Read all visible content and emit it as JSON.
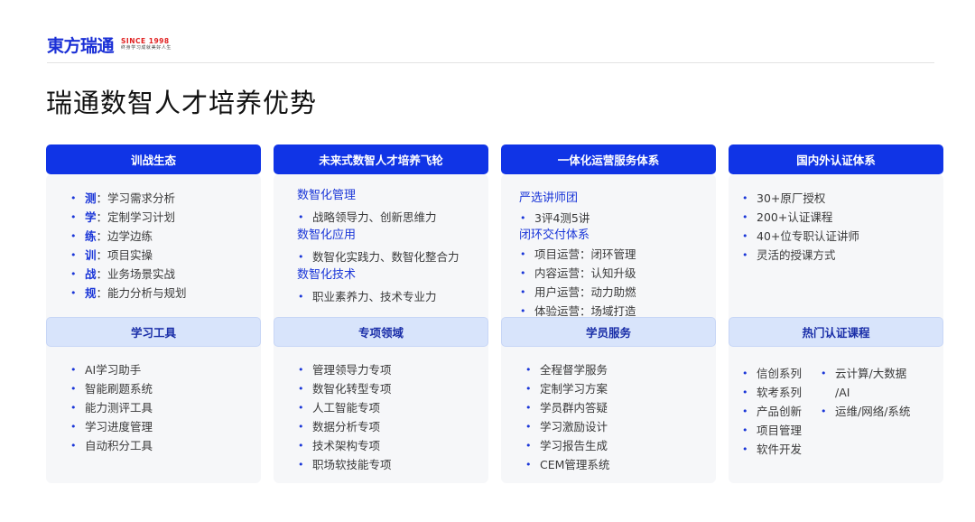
{
  "logo": {
    "name": "東方瑞通",
    "since": "SINCE 1998",
    "slogan": "终身学习成就美好人生"
  },
  "title": "瑞通数智人才培养优势",
  "col1": {
    "header": "训战生态",
    "items": [
      {
        "key": "测",
        "text": "：学习需求分析"
      },
      {
        "key": "学",
        "text": "：定制学习计划"
      },
      {
        "key": "练",
        "text": "：边学边练"
      },
      {
        "key": "训",
        "text": "：项目实操"
      },
      {
        "key": "战",
        "text": "：业务场景实战"
      },
      {
        "key": "规",
        "text": "：能力分析与规划"
      }
    ],
    "header2": "学习工具",
    "items2": [
      "AI学习助手",
      "智能刷题系统",
      "能力测评工具",
      "学习进度管理",
      "自动积分工具"
    ]
  },
  "col2": {
    "header": "未来式数智人才培养飞轮",
    "sections": [
      {
        "title": "数智化管理",
        "item": "战略领导力、创新思维力"
      },
      {
        "title": "数智化应用",
        "item": "数智化实践力、数智化整合力"
      },
      {
        "title": "数智化技术",
        "item": "职业素养力、技术专业力"
      }
    ],
    "header2": "专项领域",
    "items2": [
      "管理领导力专项",
      "数智化转型专项",
      "人工智能专项",
      "数据分析专项",
      "技术架构专项",
      "职场软技能专项"
    ]
  },
  "col3": {
    "header": "一体化运营服务体系",
    "sub1": "严选讲师团",
    "items1": [
      "3评4测5讲"
    ],
    "sub2": "闭环交付体系",
    "items2": [
      "项目运营：闭环管理",
      "内容运营：认知升级",
      "用户运营：动力助燃",
      "体验运营：场域打造"
    ],
    "header2": "学员服务",
    "items3": [
      "全程督学服务",
      "定制学习方案",
      "学员群内答疑",
      "学习激励设计",
      "学习报告生成",
      "CEM管理系统"
    ]
  },
  "col4": {
    "header": "国内外认证体系",
    "items": [
      "30+原厂授权",
      "200+认证课程",
      "40+位专职认证讲师",
      "灵活的授课方式"
    ],
    "header2": "热门认证课程",
    "itemsA": [
      "信创系列",
      "软考系列",
      "产品创新",
      "项目管理",
      "软件开发"
    ],
    "itemsB": [
      "云计算/大数据",
      "/AI",
      "运维/网络/系统"
    ]
  },
  "colors": {
    "primary": "#1034e6",
    "secondary": "#d8e4fb",
    "panel": "#f6f7f9"
  }
}
